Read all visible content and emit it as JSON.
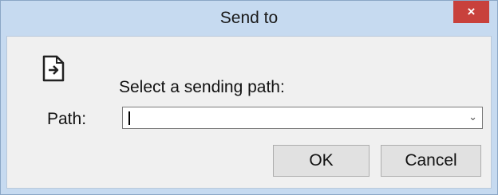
{
  "window": {
    "title": "Send to",
    "close_label": "×"
  },
  "dialog": {
    "icon": "send-file-icon",
    "prompt": "Select a sending path:",
    "path_label": "Path:",
    "path_value": "",
    "ok_label": "OK",
    "cancel_label": "Cancel"
  },
  "colors": {
    "titlebar": "#c6daf0",
    "close_button": "#c8413c",
    "client_bg": "#f0f0f0",
    "button_bg": "#e1e1e1"
  }
}
